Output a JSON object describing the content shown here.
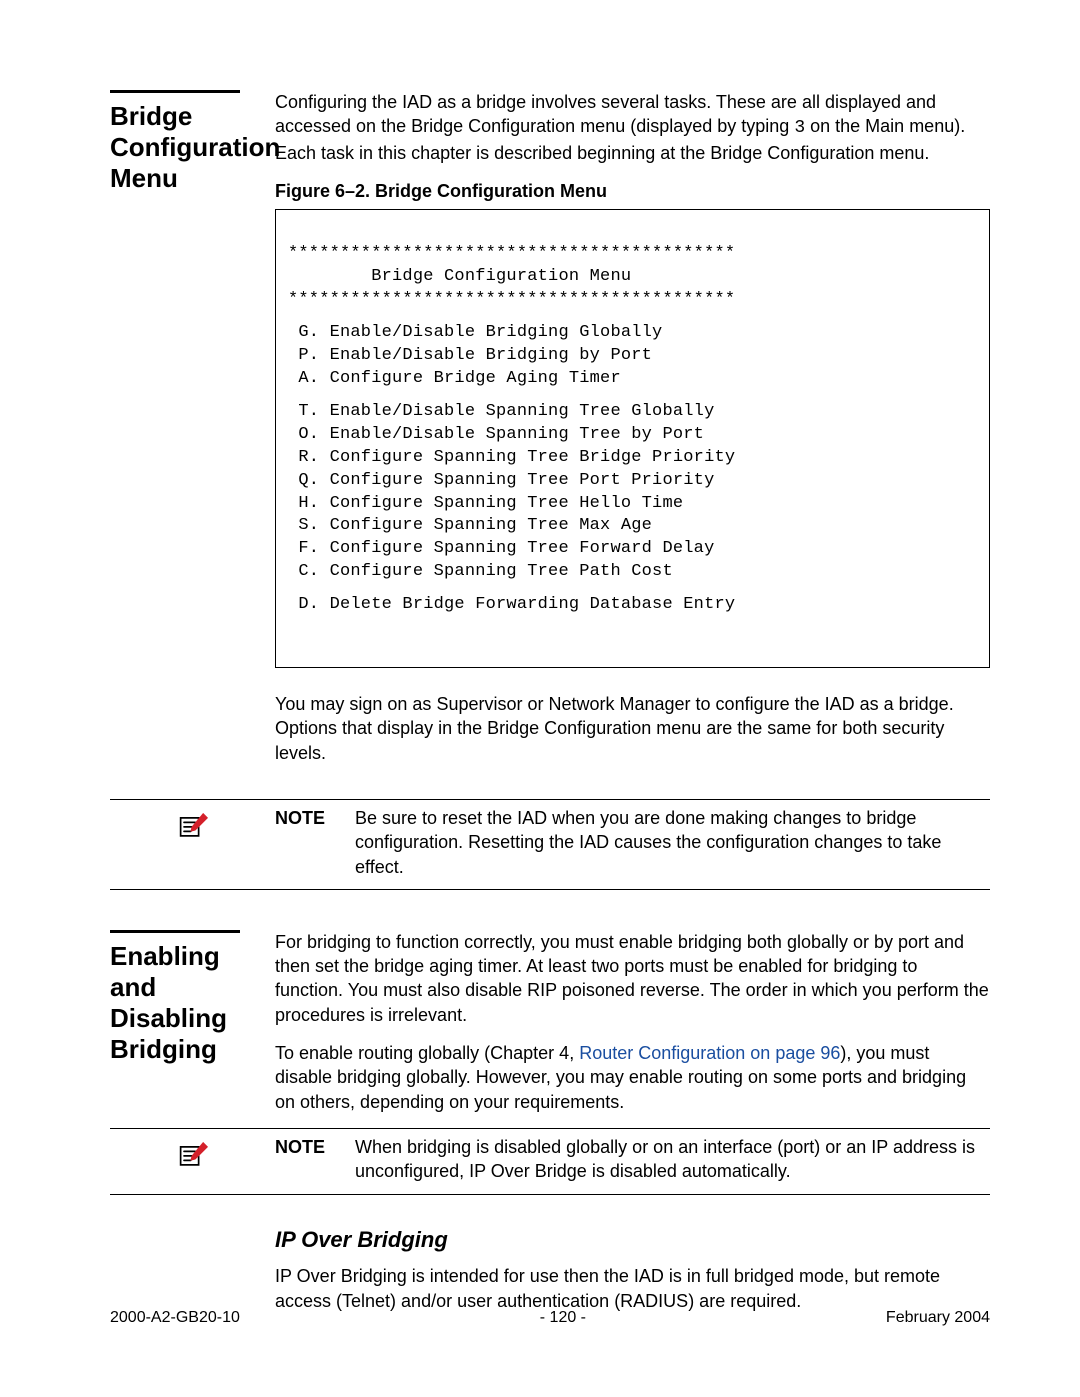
{
  "section1": {
    "heading": "Bridge Configuration Menu",
    "intro_parts": {
      "before_mono": "Configuring the IAD as a bridge involves several tasks. These are all displayed and accessed on the Bridge Configuration menu (displayed by typing ",
      "mono": "3",
      "after_mono": " on the Main menu). Each task in this chapter is described beginning at the Bridge Configuration menu."
    },
    "figure_caption": "Figure 6–2.  Bridge Configuration Menu",
    "term": {
      "stars": "*******************************************",
      "title": "        Bridge Configuration Menu",
      "group1": [
        " G. Enable/Disable Bridging Globally",
        " P. Enable/Disable Bridging by Port",
        " A. Configure Bridge Aging Timer"
      ],
      "group2": [
        " T. Enable/Disable Spanning Tree Globally",
        " O. Enable/Disable Spanning Tree by Port",
        " R. Configure Spanning Tree Bridge Priority",
        " Q. Configure Spanning Tree Port Priority",
        " H. Configure Spanning Tree Hello Time",
        " S. Configure Spanning Tree Max Age",
        " F. Configure Spanning Tree Forward Delay",
        " C. Configure Spanning Tree Path Cost"
      ],
      "group3": [
        " D. Delete Bridge Forwarding Database Entry"
      ]
    },
    "after": "You may sign on as Supervisor or Network Manager to configure the IAD as a bridge. Options that display in the Bridge Configuration menu are the same for both security levels.",
    "note_label": "NOTE",
    "note_text": "Be sure to reset the IAD when you are done making changes to bridge configuration. Resetting the IAD causes the configuration changes to take effect."
  },
  "section2": {
    "heading": "Enabling and Disabling Bridging",
    "p1": "For bridging to function correctly, you must enable bridging both globally or by port and then set the bridge aging timer. At least two ports must be enabled for bridging to function. You must also disable RIP poisoned reverse. The order in which you perform the procedures is irrelevant.",
    "p2_before": "To enable routing globally (Chapter 4, ",
    "p2_link": "Router Configuration on page 96",
    "p2_after": "), you must disable bridging globally. However, you may enable routing on some ports and bridging on others, depending on your requirements.",
    "note_label": "NOTE",
    "note_text": "When bridging is disabled globally or on an interface (port) or an IP address is unconfigured, IP Over Bridge is disabled automatically.",
    "subhead": "IP Over Bridging",
    "p3": "IP Over Bridging is intended for use then the IAD is in full bridged mode, but remote access (Telnet) and/or user authentication (RADIUS) are required."
  },
  "footer": {
    "left": "2000-A2-GB20-10",
    "center": "- 120 -",
    "right": "February 2004"
  }
}
